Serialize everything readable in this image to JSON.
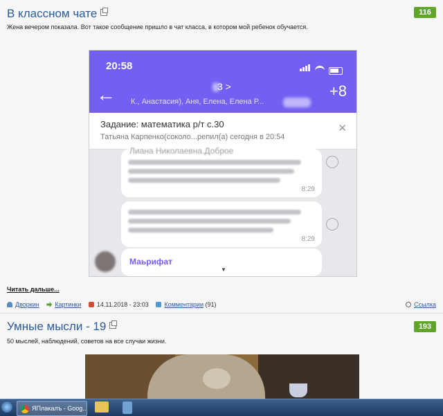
{
  "post1": {
    "title": "В классном чате",
    "rating": "116",
    "description": "Жена вечером показала. Вот такое сообщение пришло в чат класса, в котором мой ребенок обучается.",
    "screenshot": {
      "time": "20:58",
      "chat_title": "3 >",
      "members": "К., Анастасия), Аня, Елена, Елена Р...",
      "task_title": "Задание: математика р/т с.30",
      "task_sub": "Татьяна Карпенко(соколо...репил(а) сегодня в 20:54",
      "msg1_partial": "Лиана Николаевна.Доброе",
      "msg1_time": "8:29",
      "msg2_time": "8:29",
      "sender_name": "Маьрифат"
    },
    "read_more": "Читать дальше...",
    "author": "Дворкин",
    "category": "Картинки",
    "date": "14.11.2018 - 23:03",
    "comments_label": "Комментарии",
    "comments_count": "(91)",
    "link_label": "Ссылка"
  },
  "post2": {
    "title": "Умные мысли - 19",
    "rating": "193",
    "description": "50 мыслей, наблюдений, советов на все случаи жизни."
  },
  "taskbar": {
    "app_label": "ЯПлакалъ - Goog..."
  },
  "colors": {
    "title_link": "#2a5a9a",
    "rating_badge": "#5fa52a",
    "viber_purple": "#7360f2"
  }
}
